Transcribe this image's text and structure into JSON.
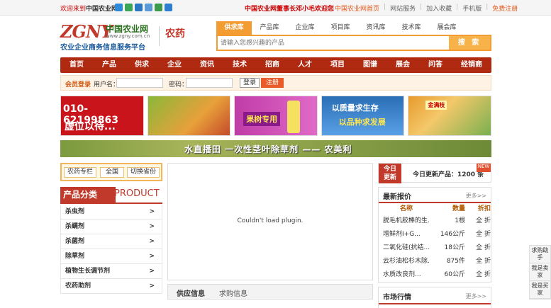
{
  "topbar": {
    "welcome": "欢迎来到",
    "site": "中国农业网",
    "slogan": "中国农业网董事长邓小毛欢迎您",
    "links": [
      "中国农业网首页",
      "网站服务",
      "加入收藏",
      "手机版",
      "免费注册"
    ]
  },
  "logo": {
    "mark": "ZGNY",
    "name": "中国农业网",
    "url": "www.zgny.com.cn",
    "subtitle": "农业企业商务信息服务平台"
  },
  "channel": "农药",
  "search": {
    "tabs": [
      "供求库",
      "产品库",
      "企业库",
      "项目库",
      "资讯库",
      "技术库",
      "展会库"
    ],
    "placeholder": "请输入您感兴趣的产品",
    "button": "搜 索"
  },
  "nav": [
    "首页",
    "产品",
    "供求",
    "企业",
    "资讯",
    "技术",
    "招商",
    "人才",
    "项目",
    "图谱",
    "展会",
    "问答",
    "经销商"
  ],
  "login": {
    "title": "会员登录",
    "user_label": "用户名：",
    "pass_label": "密码：",
    "login": "登录",
    "register": "注册"
  },
  "ads": {
    "phone": "010-62199863",
    "vacant": "虚位以待...",
    "fruit": "果树专用",
    "quality1": "以质量求生存",
    "quality2": "以品种求发展",
    "brand": "金满枝"
  },
  "banner": "水直播田 一次性茎叶除草剂 —— 农美利",
  "leftbar": {
    "b1": "农药专栏",
    "b2": "全国",
    "b3": "切换省份"
  },
  "products": {
    "title_cn": "产品分类",
    "title_en": "PRODUCT",
    "items": [
      "杀虫剂",
      "杀螨剂",
      "杀菌剂",
      "除草剂",
      "植物生长调节剂",
      "农药助剂"
    ],
    "arrow": ">"
  },
  "plugin": "Couldn't load plugin.",
  "supply_tabs": {
    "supply": "供应信息",
    "demand": "求购信息"
  },
  "today": {
    "badge1": "今日",
    "badge2": "更新",
    "text": "今日更新产品：1200 条",
    "corner": "NEW"
  },
  "quotes": {
    "title": "最新报价",
    "more": "更多>>",
    "cols": [
      "名称",
      "数量",
      "折扣"
    ],
    "rows": [
      [
        "脱毛机胶棒的生...",
        "1根",
        "全 折"
      ],
      [
        "增鲜剂I+G...",
        "146公斤",
        "全 折"
      ],
      [
        "二氧化硅(抗结...",
        "18公斤",
        "全 折"
      ],
      [
        "云杉油松杉木除...",
        "875件",
        "全 折"
      ],
      [
        "水质改良剂...",
        "60公斤",
        "全 折"
      ]
    ]
  },
  "market": {
    "title": "市场行情",
    "more": "更多>>"
  },
  "sidebar": [
    "求购助手",
    "我是卖家",
    "我是买家"
  ]
}
